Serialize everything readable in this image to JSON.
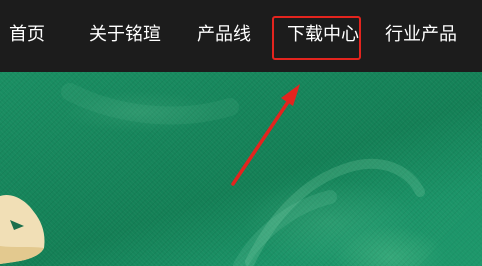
{
  "nav": {
    "items": [
      {
        "label": "首页"
      },
      {
        "label": "关于铭瑄"
      },
      {
        "label": "产品线"
      },
      {
        "label": "下载中心"
      },
      {
        "label": "行业产品"
      }
    ]
  },
  "colors": {
    "navbar_bg": "#1c1c1c",
    "nav_text": "#ffffff",
    "highlight": "#e3241e",
    "banner_green": "#16855b"
  }
}
